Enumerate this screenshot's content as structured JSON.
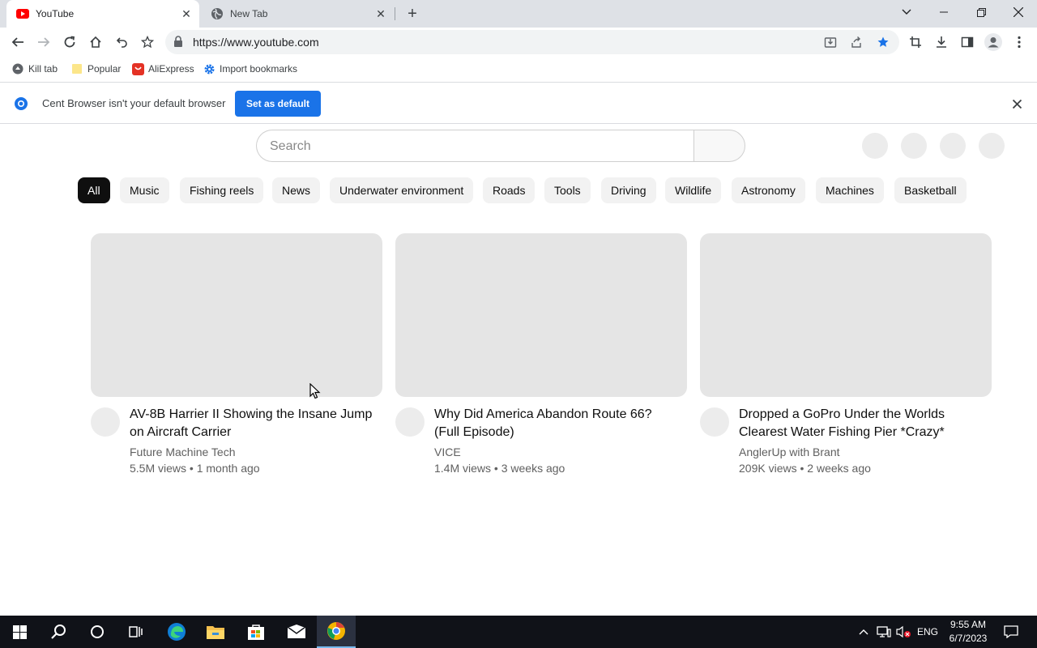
{
  "browser": {
    "tabs": [
      {
        "label": "YouTube",
        "icon": "youtube-icon",
        "active": true
      },
      {
        "label": "New Tab",
        "icon": "globe-icon",
        "active": false
      }
    ],
    "url": "https://www.youtube.com",
    "bookmarks": [
      {
        "label": "Kill tab",
        "icon": "kill-tab-icon"
      },
      {
        "label": "Popular",
        "icon": "folder-icon"
      },
      {
        "label": "AliExpress",
        "icon": "aliexpress-icon"
      },
      {
        "label": "Import bookmarks",
        "icon": "gear-icon"
      }
    ],
    "infobar": {
      "message": "Cent Browser isn't your default browser",
      "button": "Set as default"
    },
    "colors": {
      "accent": "#1a73e8",
      "tabstrip": "#dee1e6"
    }
  },
  "youtube": {
    "search_placeholder": "Search",
    "chips": [
      "All",
      "Music",
      "Fishing reels",
      "News",
      "Underwater environment",
      "Roads",
      "Tools",
      "Driving",
      "Wildlife",
      "Astronomy",
      "Machines",
      "Basketball"
    ],
    "videos": [
      {
        "title": "AV-8B Harrier II Showing the Insane Jump on Aircraft Carrier",
        "channel": "Future Machine Tech",
        "views": "5.5M views",
        "age": "1 month ago"
      },
      {
        "title": "Why Did America Abandon Route 66? (Full Episode)",
        "channel": "VICE",
        "views": "1.4M views",
        "age": "3 weeks ago"
      },
      {
        "title": "Dropped a GoPro Under the Worlds Clearest Water Fishing Pier *Crazy*",
        "channel": "AnglerUp with Brant",
        "views": "209K views",
        "age": "2 weeks ago"
      }
    ]
  },
  "taskbar": {
    "apps": [
      "windows-start-icon",
      "search-icon",
      "cortana-icon",
      "task-view-icon",
      "edge-icon",
      "file-explorer-icon",
      "store-icon",
      "mail-icon",
      "cent-browser-icon"
    ],
    "language": "ENG",
    "time": "9:55 AM",
    "date": "6/7/2023"
  }
}
